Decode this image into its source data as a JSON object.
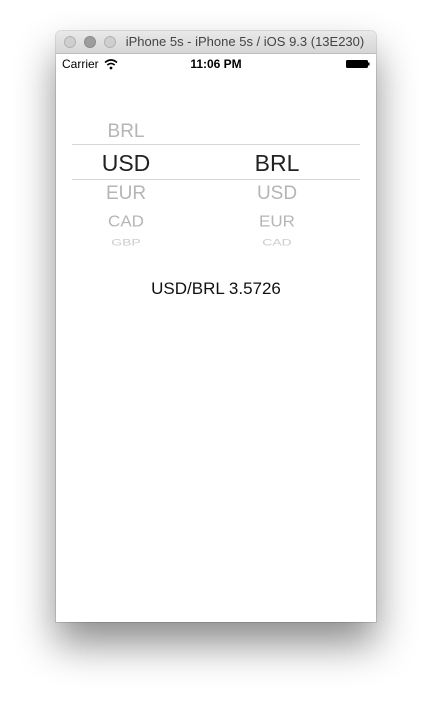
{
  "window": {
    "title": "iPhone 5s - iPhone 5s / iOS 9.3 (13E230)"
  },
  "status_bar": {
    "carrier": "Carrier",
    "time": "11:06 PM"
  },
  "picker": {
    "from": {
      "above": [
        "BRL"
      ],
      "selected": "USD",
      "below": [
        "EUR",
        "CAD",
        "GBP",
        ""
      ]
    },
    "to": {
      "above": [
        ""
      ],
      "selected": "BRL",
      "below": [
        "USD",
        "EUR",
        "CAD",
        ""
      ]
    }
  },
  "rate_text": "USD/BRL 3.5726",
  "icons": {
    "wifi": "wifi-icon",
    "battery": "battery-icon"
  }
}
